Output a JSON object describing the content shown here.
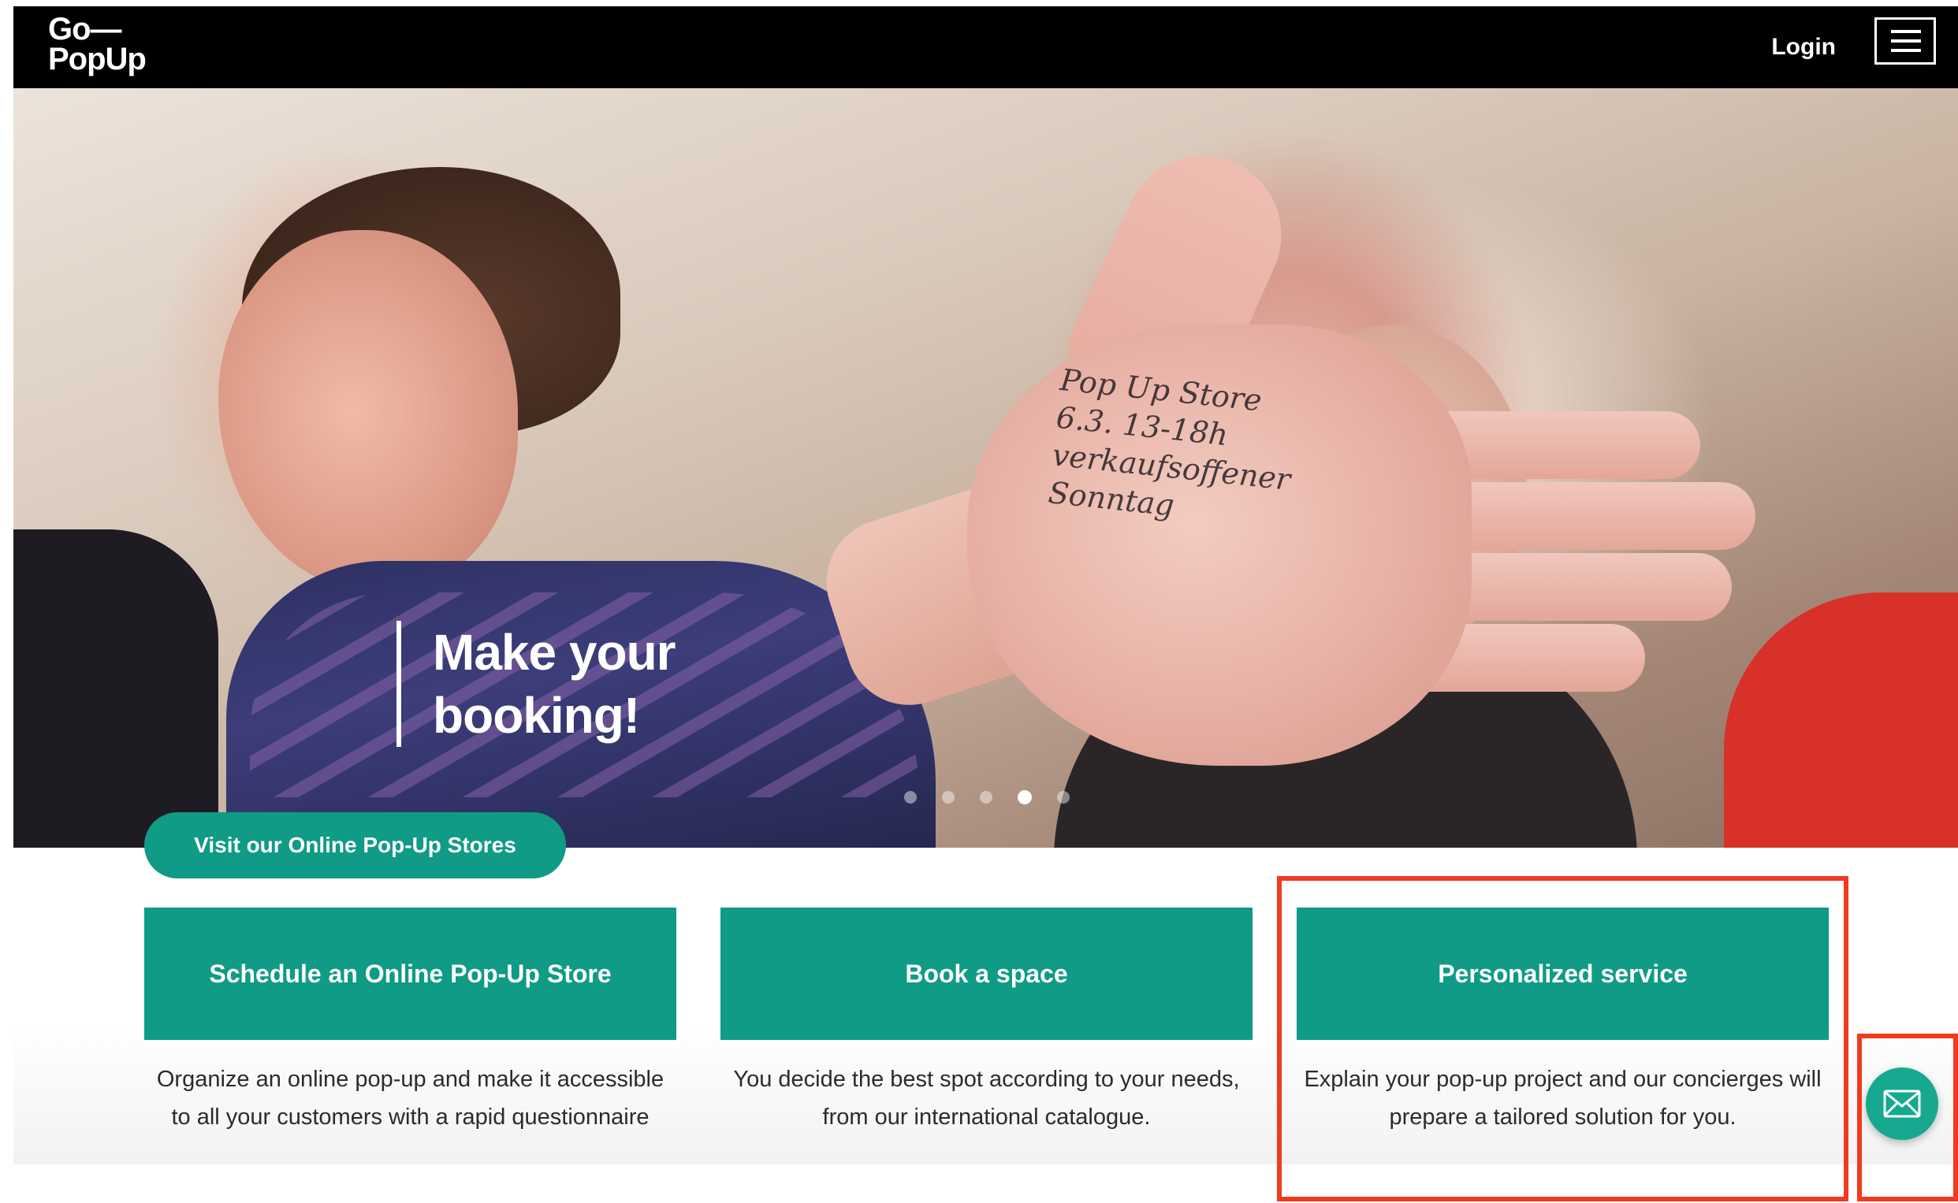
{
  "header": {
    "logo_line1": "Go—",
    "logo_line2": "PopUp",
    "login_label": "Login",
    "menu_icon": "hamburger-menu-icon"
  },
  "hero": {
    "headline": "Make your booking!",
    "palm_note": "Pop Up Store 6.3. 13-18h verkaufsoffener Sonntag",
    "carousel": {
      "slide_count": 5,
      "active_slide": 4
    }
  },
  "online_store_button": {
    "label": "Visit our Online Pop-Up Stores"
  },
  "cards": [
    {
      "title": "Schedule an Online Pop-Up Store",
      "description": "Organize an online pop-up and make it accessible to all your customers with a rapid questionnaire"
    },
    {
      "title": "Book a space",
      "description": "You decide the best spot according to your needs, from our international catalogue."
    },
    {
      "title": "Personalized service",
      "description": "Explain your pop-up project and our concierges will prepare a tailored solution for you."
    }
  ],
  "contact": {
    "icon": "envelope-icon"
  },
  "colors": {
    "header_bg": "#000000",
    "accent": "#0f9b85",
    "contact_bubble": "#16a98f",
    "highlight": "#f03a1e"
  }
}
